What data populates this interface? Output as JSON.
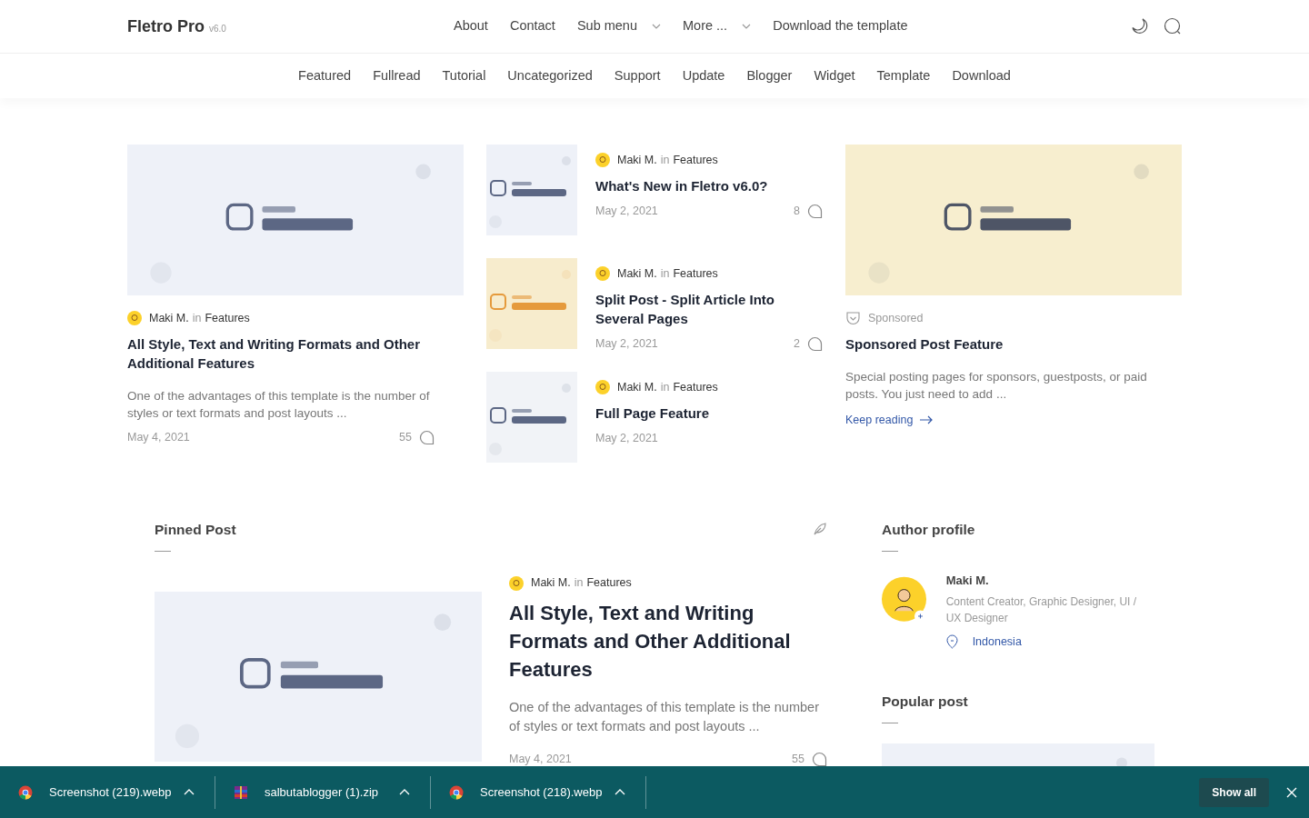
{
  "brand": {
    "name": "Fletro Pro",
    "version": "v6.0"
  },
  "top_menu": [
    {
      "label": "About",
      "has_dropdown": false
    },
    {
      "label": "Contact",
      "has_dropdown": false
    },
    {
      "label": "Sub menu",
      "has_dropdown": true
    },
    {
      "label": "More ...",
      "has_dropdown": true
    },
    {
      "label": "Download the template",
      "has_dropdown": false
    }
  ],
  "category_menu": [
    "Featured",
    "Fullread",
    "Tutorial",
    "Uncategorized",
    "Support",
    "Update",
    "Blogger",
    "Widget",
    "Template",
    "Download"
  ],
  "featured_post": {
    "meta": {
      "author": "Maki M.",
      "preposition": "in",
      "category": "Features"
    },
    "title": "All Style, Text and Writing Formats and Other Additional Features",
    "excerpt": "One of the advantages of this template is the number of styles or text formats and post layouts ...",
    "date": "May 4, 2021",
    "comments": "55"
  },
  "side_posts": [
    {
      "meta": {
        "author": "Maki M.",
        "preposition": "in",
        "category": "Features"
      },
      "title": "What's New in Fletro v6.0?",
      "date": "May 2, 2021",
      "comments": "8"
    },
    {
      "meta": {
        "author": "Maki M.",
        "preposition": "in",
        "category": "Features"
      },
      "title": "Split Post - Split Article Into Several Pages",
      "date": "May 2, 2021",
      "comments": "2"
    },
    {
      "meta": {
        "author": "Maki M.",
        "preposition": "in",
        "category": "Features"
      },
      "title": "Full Page Feature",
      "date": "May 2, 2021"
    }
  ],
  "sponsored_post": {
    "label": "Sponsored",
    "title": "Sponsored Post Feature",
    "excerpt": "Special posting pages for sponsors, guestposts, or paid posts. You just need to add ...",
    "link": "Keep reading"
  },
  "pinned": {
    "heading": "Pinned Post",
    "post": {
      "meta": {
        "author": "Maki M.",
        "preposition": "in",
        "category": "Features"
      },
      "title": "All Style, Text and Writing Formats and Other Additional Features",
      "excerpt": "One of the advantages of this template is the number of styles or text formats and post layouts ...",
      "date": "May 4, 2021",
      "comments": "55"
    }
  },
  "author_profile": {
    "heading": "Author profile",
    "name": "Maki M.",
    "bio": "Content Creator, Graphic Designer, UI / UX Designer",
    "location": "Indonesia"
  },
  "popular": {
    "heading": "Popular post"
  },
  "downloads": [
    {
      "filename": "Screenshot (219).webp"
    },
    {
      "filename": "salbutablogger (1).zip",
      "kind": "archive"
    },
    {
      "filename": "Screenshot (218).webp"
    }
  ],
  "show_all": "Show all"
}
